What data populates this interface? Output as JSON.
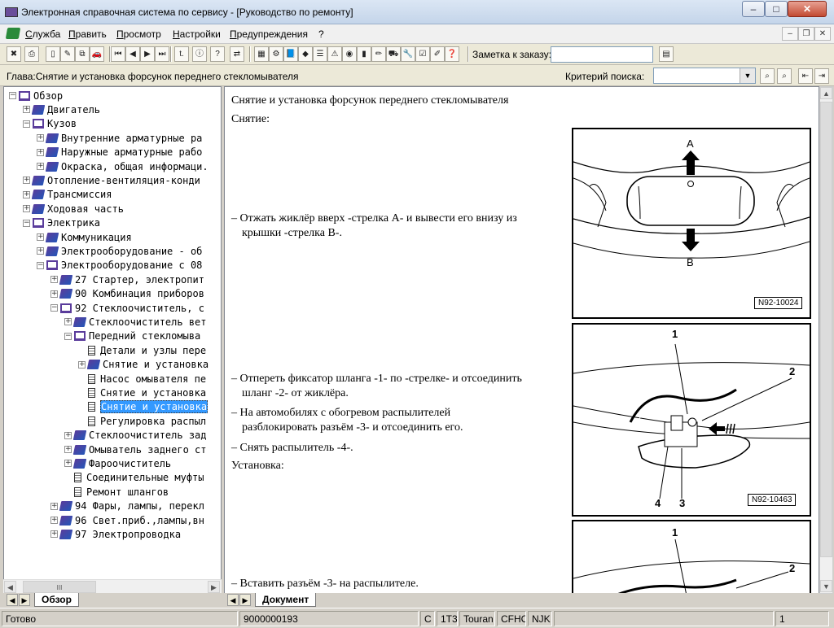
{
  "window": {
    "title": "Электронная справочная система по сервису - [Руководство по ремонту]",
    "controls": {
      "minimize": "–",
      "maximize": "□",
      "close": "✕"
    }
  },
  "menu": {
    "items": [
      "Служба",
      "Править",
      "Просмотр",
      "Настройки",
      "Предупреждения",
      "?"
    ],
    "mdi": {
      "minimize": "–",
      "restore": "❐",
      "close": "✕"
    }
  },
  "toolbar": {
    "note_label": "Заметка к заказу:",
    "note_value": "",
    "buttons": [
      {
        "icon": "exit-icon",
        "glyph": "✖"
      },
      {
        "icon": "print-icon",
        "glyph": "⎙"
      },
      {
        "icon": "new-doc-icon",
        "glyph": "▯"
      },
      {
        "icon": "edit-icon",
        "glyph": "✎"
      },
      {
        "icon": "copy-icon",
        "glyph": "⧉"
      },
      {
        "icon": "car-icon",
        "glyph": "🚗"
      },
      {
        "icon": "first-icon",
        "glyph": "⏮"
      },
      {
        "icon": "prev-icon",
        "glyph": "◀"
      },
      {
        "icon": "next-icon",
        "glyph": "▶"
      },
      {
        "icon": "last-icon",
        "glyph": "⏭"
      },
      {
        "icon": "back-icon",
        "glyph": "t."
      },
      {
        "icon": "info-icon",
        "glyph": "ⓘ"
      },
      {
        "icon": "help-icon",
        "glyph": "?"
      },
      {
        "icon": "sync-icon",
        "glyph": "⇄"
      },
      {
        "icon": "calc-icon",
        "glyph": "▦"
      },
      {
        "icon": "engine-icon",
        "glyph": "⚙"
      },
      {
        "icon": "book-icon",
        "glyph": "📘"
      },
      {
        "icon": "diamond-icon",
        "glyph": "◆"
      },
      {
        "icon": "list-icon",
        "glyph": "☰"
      },
      {
        "icon": "warning-icon",
        "glyph": "⚠"
      },
      {
        "icon": "globe-icon",
        "glyph": "◉"
      },
      {
        "icon": "battery-icon",
        "glyph": "▮"
      },
      {
        "icon": "paint-icon",
        "glyph": "✏"
      },
      {
        "icon": "car2-icon",
        "glyph": "⛟"
      },
      {
        "icon": "tools-icon",
        "glyph": "🔧"
      },
      {
        "icon": "check-icon",
        "glyph": "☑"
      },
      {
        "icon": "notes-icon",
        "glyph": "✐"
      },
      {
        "icon": "question-doc-icon",
        "glyph": "❓"
      }
    ],
    "right_button": {
      "icon": "order-icon",
      "glyph": "▤"
    }
  },
  "criteria_bar": {
    "chapter": "Глава:Снятие и установка форсунок переднего стекломывателя",
    "criteria_label": "Критерий поиска:",
    "criteria_value": "",
    "dropdown": "▼",
    "buttons": [
      {
        "icon": "search-prev-icon",
        "glyph": "⌕"
      },
      {
        "icon": "search-next-icon",
        "glyph": "⌕"
      },
      {
        "icon": "goto-prev-icon",
        "glyph": "⇤"
      },
      {
        "icon": "goto-next-icon",
        "glyph": "⇥"
      }
    ]
  },
  "tree": {
    "items": [
      {
        "label": "Обзор",
        "level": 0,
        "exp": "−",
        "icon": "open"
      },
      {
        "label": "Двигатель",
        "level": 1,
        "exp": "+",
        "icon": "book"
      },
      {
        "label": "Кузов",
        "level": 1,
        "exp": "−",
        "icon": "open"
      },
      {
        "label": "Внутренние арматурные ра",
        "level": 2,
        "exp": "+",
        "icon": "book"
      },
      {
        "label": "Наружные арматурные рабо",
        "level": 2,
        "exp": "+",
        "icon": "book"
      },
      {
        "label": "Окраска, общая информаци.",
        "level": 2,
        "exp": "+",
        "icon": "book"
      },
      {
        "label": "Отопление-вентиляция-конди",
        "level": 1,
        "exp": "+",
        "icon": "book"
      },
      {
        "label": "Трансмиссия",
        "level": 1,
        "exp": "+",
        "icon": "book"
      },
      {
        "label": "Ходовая часть",
        "level": 1,
        "exp": "+",
        "icon": "book"
      },
      {
        "label": "Электрика",
        "level": 1,
        "exp": "−",
        "icon": "open"
      },
      {
        "label": "Коммуникация",
        "level": 2,
        "exp": "+",
        "icon": "book"
      },
      {
        "label": "Электрооборудование - об",
        "level": 2,
        "exp": "+",
        "icon": "book"
      },
      {
        "label": "Электрооборудование с 08",
        "level": 2,
        "exp": "−",
        "icon": "open"
      },
      {
        "label": "27 Стартер, электропит",
        "level": 3,
        "exp": "+",
        "icon": "book"
      },
      {
        "label": "90 Комбинация приборов",
        "level": 3,
        "exp": "+",
        "icon": "book"
      },
      {
        "label": "92 Стеклоочиститель, с",
        "level": 3,
        "exp": "−",
        "icon": "open"
      },
      {
        "label": "Стеклоочиститель вет",
        "level": 4,
        "exp": "+",
        "icon": "book"
      },
      {
        "label": "Передний стекломыва",
        "level": 4,
        "exp": "−",
        "icon": "open"
      },
      {
        "label": "Детали и узлы пере",
        "level": 5,
        "exp": "",
        "icon": "doc"
      },
      {
        "label": "Снятие и установка",
        "level": 5,
        "exp": "+",
        "icon": "book"
      },
      {
        "label": "Насос омывателя пе",
        "level": 5,
        "exp": "",
        "icon": "doc"
      },
      {
        "label": "Снятие и установка",
        "level": 5,
        "exp": "",
        "icon": "doc"
      },
      {
        "label": "Снятие и установка",
        "level": 5,
        "exp": "",
        "icon": "doc",
        "selected": true
      },
      {
        "label": "Регулировка распыл",
        "level": 5,
        "exp": "",
        "icon": "doc"
      },
      {
        "label": "Стеклоочиститель зад",
        "level": 4,
        "exp": "+",
        "icon": "book"
      },
      {
        "label": "Омыватель заднего ст",
        "level": 4,
        "exp": "+",
        "icon": "book"
      },
      {
        "label": "Фароочиститель",
        "level": 4,
        "exp": "+",
        "icon": "book"
      },
      {
        "label": "Соединительные муфты",
        "level": 4,
        "exp": "",
        "icon": "doc"
      },
      {
        "label": "Ремонт шлангов",
        "level": 4,
        "exp": "",
        "icon": "doc"
      },
      {
        "label": "94 Фары, лампы, перекл",
        "level": 3,
        "exp": "+",
        "icon": "book"
      },
      {
        "label": "96 Свет.приб.,лампы,вн",
        "level": 3,
        "exp": "+",
        "icon": "book"
      },
      {
        "label": "97 Электропроводка",
        "level": 3,
        "exp": "+",
        "icon": "book"
      }
    ],
    "tab_label": "Обзор",
    "scroll_grip": "III"
  },
  "document": {
    "heading": "Снятие и установка форсунок переднего стекломывателя",
    "removal_label": "Снятие:",
    "step1_line1": "– Отжать жиклёр вверх -стрелка А- и вывести его внизу из",
    "step1_line2": "крышки -стрелка В-.",
    "step2_line1": "– Отпереть фиксатор шланга -1- по -стрелке- и отсоединить",
    "step2_line2": "шланг -2- от жиклёра.",
    "step3_line1": "– На автомобилях с обогревом распылителей",
    "step3_line2": "разблокировать разъём -3- и отсоединить его.",
    "step4": "– Снять распылитель -4-.",
    "install_label": "Установка:",
    "step5": "– Вставить разъём -3- на распылителе.",
    "fig1": {
      "label": "N92-10024",
      "a": "A",
      "b": "B"
    },
    "fig2": {
      "label": "N92-10463",
      "n1": "1",
      "n2": "2",
      "n3": "3",
      "n4": "4"
    },
    "fig3": {
      "n1": "1",
      "n2": "2"
    },
    "tab_label": "Документ"
  },
  "status": {
    "ready": "Готово",
    "order": "9000000193",
    "c": "C",
    "model_code": "1T3",
    "model": "Touran",
    "engine": "CFHC",
    "gearbox": "NJK",
    "page": "1"
  }
}
